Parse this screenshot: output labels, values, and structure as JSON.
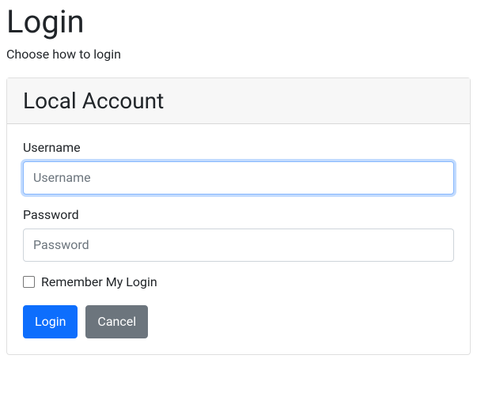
{
  "page": {
    "title": "Login",
    "subtitle": "Choose how to login"
  },
  "card": {
    "header_title": "Local Account"
  },
  "form": {
    "username": {
      "label": "Username",
      "placeholder": "Username",
      "value": ""
    },
    "password": {
      "label": "Password",
      "placeholder": "Password",
      "value": ""
    },
    "remember": {
      "label": "Remember My Login",
      "checked": false
    },
    "buttons": {
      "login": "Login",
      "cancel": "Cancel"
    }
  }
}
